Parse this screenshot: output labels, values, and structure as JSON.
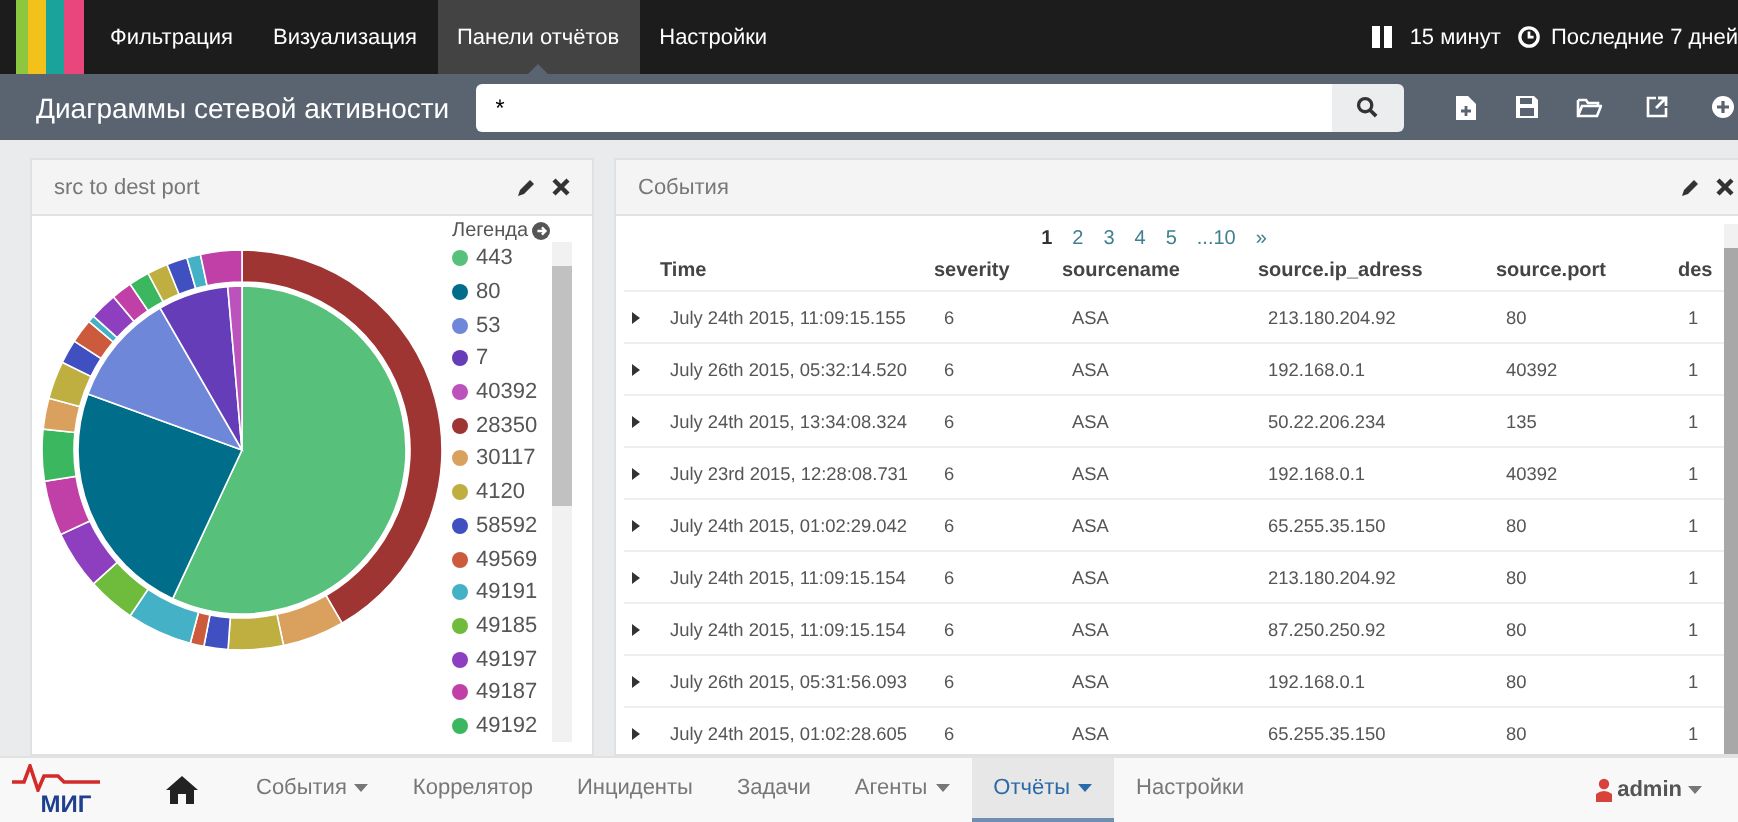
{
  "top_nav": {
    "items": [
      {
        "label": "Фильтрация",
        "selected": false
      },
      {
        "label": "Визуализация",
        "selected": false
      },
      {
        "label": "Панели отчётов",
        "selected": true
      },
      {
        "label": "Настройки",
        "selected": false
      }
    ],
    "refresh": "15 минут",
    "time_range": "Последние 7 дней"
  },
  "dashboard": {
    "title": "Диаграммы сетевой активности",
    "search": {
      "value": "*"
    }
  },
  "chart_panel": {
    "title": "src to dest port",
    "legend_title": "Легенда",
    "legend": [
      {
        "label": "443",
        "color": "#57c17b"
      },
      {
        "label": "80",
        "color": "#006e8a"
      },
      {
        "label": "53",
        "color": "#6f87d8"
      },
      {
        "label": "7",
        "color": "#663db8"
      },
      {
        "label": "40392",
        "color": "#bc52bc"
      },
      {
        "label": "28350",
        "color": "#9e3533"
      },
      {
        "label": "30117",
        "color": "#daa05d"
      },
      {
        "label": "4120",
        "color": "#bfaf40"
      },
      {
        "label": "58592",
        "color": "#4050c0"
      },
      {
        "label": "49569",
        "color": "#cc5a3c"
      },
      {
        "label": "49191",
        "color": "#44b1c7"
      },
      {
        "label": "49185",
        "color": "#6fbb3c"
      },
      {
        "label": "49197",
        "color": "#8e3fbf"
      },
      {
        "label": "49187",
        "color": "#c140a8"
      },
      {
        "label": "49192",
        "color": "#3bb85f"
      }
    ]
  },
  "events_panel": {
    "title": "События",
    "pagination": [
      {
        "label": "1",
        "selected": true
      },
      {
        "label": "2",
        "selected": false
      },
      {
        "label": "3",
        "selected": false
      },
      {
        "label": "4",
        "selected": false
      },
      {
        "label": "5",
        "selected": false
      },
      {
        "label": "...10",
        "selected": false
      },
      {
        "label": "»",
        "selected": false
      }
    ],
    "columns": [
      "Time",
      "severity",
      "sourcename",
      "source.ip_adress",
      "source.port",
      "des"
    ],
    "rows": [
      [
        "July 24th 2015, 11:09:15.155",
        "6",
        "ASA",
        "213.180.204.92",
        "80",
        "1"
      ],
      [
        "July 26th 2015, 05:32:14.520",
        "6",
        "ASA",
        "192.168.0.1",
        "40392",
        "1"
      ],
      [
        "July 24th 2015, 13:34:08.324",
        "6",
        "ASA",
        "50.22.206.234",
        "135",
        "1"
      ],
      [
        "July 23rd 2015, 12:28:08.731",
        "6",
        "ASA",
        "192.168.0.1",
        "40392",
        "1"
      ],
      [
        "July 24th 2015, 01:02:29.042",
        "6",
        "ASA",
        "65.255.35.150",
        "80",
        "1"
      ],
      [
        "July 24th 2015, 11:09:15.154",
        "6",
        "ASA",
        "213.180.204.92",
        "80",
        "1"
      ],
      [
        "July 24th 2015, 11:09:15.154",
        "6",
        "ASA",
        "87.250.250.92",
        "80",
        "1"
      ],
      [
        "July 26th 2015, 05:31:56.093",
        "6",
        "ASA",
        "192.168.0.1",
        "80",
        "1"
      ],
      [
        "July 24th 2015, 01:02:28.605",
        "6",
        "ASA",
        "65.255.35.150",
        "80",
        "1"
      ]
    ]
  },
  "bottom_nav": {
    "logo": "МИГ",
    "items": [
      {
        "label": "События",
        "dropdown": true,
        "selected": false
      },
      {
        "label": "Коррелятор",
        "dropdown": false,
        "selected": false
      },
      {
        "label": "Инциденты",
        "dropdown": false,
        "selected": false
      },
      {
        "label": "Задачи",
        "dropdown": false,
        "selected": false
      },
      {
        "label": "Агенты",
        "dropdown": true,
        "selected": false
      },
      {
        "label": "Отчёты",
        "dropdown": true,
        "selected": true
      },
      {
        "label": "Настройки",
        "dropdown": false,
        "selected": false
      }
    ],
    "user": "admin"
  }
}
